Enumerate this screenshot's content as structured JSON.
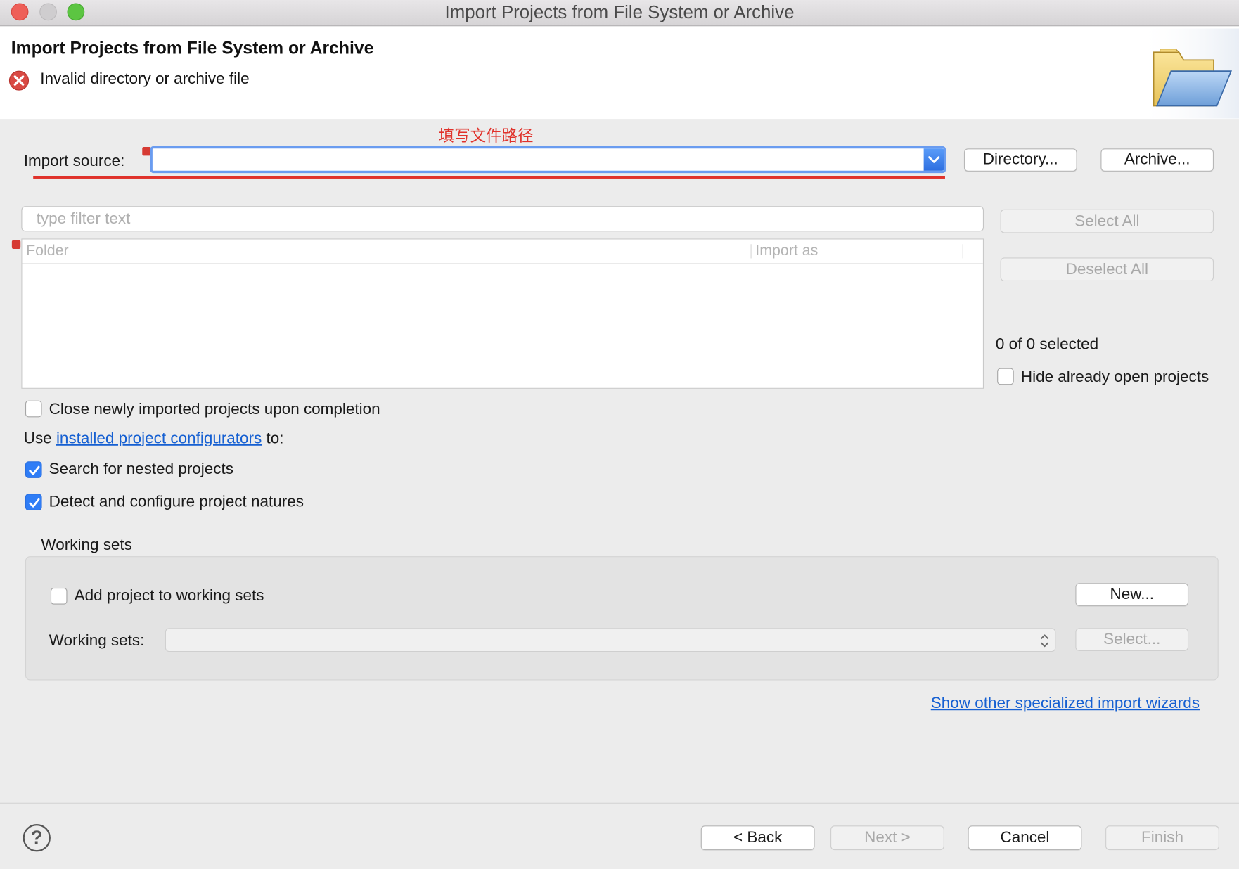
{
  "window": {
    "title": "Import Projects from File System or Archive"
  },
  "header": {
    "title": "Import Projects from File System or Archive",
    "error_message": "Invalid directory or archive file"
  },
  "annotation": {
    "text": "填写文件路径",
    "color": "#e0322b"
  },
  "import_source": {
    "label": "Import source:",
    "value": "",
    "directory_button": "Directory...",
    "archive_button": "Archive..."
  },
  "filter": {
    "placeholder": "type filter text",
    "value": ""
  },
  "table": {
    "columns": [
      "Folder",
      "Import as"
    ],
    "rows": []
  },
  "side_buttons": {
    "select_all": "Select All",
    "deselect_all": "Deselect All"
  },
  "selection_status": "0 of 0 selected",
  "options": {
    "hide_open": {
      "label": "Hide already open projects",
      "checked": false
    },
    "close_imported": {
      "label": "Close newly imported projects upon completion",
      "checked": false
    },
    "configurators_prefix": "Use",
    "configurators_link": "installed project configurators",
    "configurators_suffix": "to:",
    "search_nested": {
      "label": "Search for nested projects",
      "checked": true
    },
    "detect_natures": {
      "label": "Detect and configure project natures",
      "checked": true
    }
  },
  "working_sets": {
    "group_label": "Working sets",
    "add_label": "Add project to working sets",
    "add_checked": false,
    "new_button": "New...",
    "combo_label": "Working sets:",
    "combo_value": "",
    "select_button": "Select..."
  },
  "other_wizards_link": "Show other specialized import wizards",
  "footer": {
    "help": "?",
    "back": "< Back",
    "next": "Next >",
    "cancel": "Cancel",
    "finish": "Finish"
  },
  "colors": {
    "accent": "#2f7df6",
    "link": "#1660d2",
    "error": "#d63a33"
  },
  "icons": [
    "close-window-icon",
    "minimize-window-icon",
    "zoom-window-icon",
    "error-icon",
    "folder-icon",
    "chevron-down-icon",
    "checkmark-icon",
    "updown-arrows-icon",
    "help-icon"
  ]
}
